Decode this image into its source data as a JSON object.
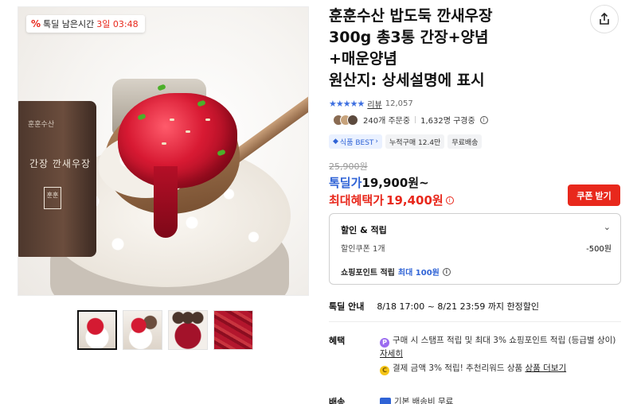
{
  "gallery": {
    "timer_badge": {
      "icon": "percent-icon",
      "label": "톡딜 남은시간",
      "time": "3일 03:48"
    },
    "jar_text": {
      "top": "훈훈수산",
      "label": "간장 깐새우장",
      "seal": "훈훈"
    },
    "thumbnails": 4
  },
  "product": {
    "title_lines": [
      "훈훈수산 밥도둑 깐새우장",
      "300g 총3통 간장+양념",
      "+매운양념",
      "원산지: 상세설명에 표시"
    ],
    "rating": {
      "stars": "★★★★★",
      "review_label": "리뷰",
      "review_count": "12,057"
    },
    "buyers": {
      "orders": "240개 주문중",
      "subscribers": "1,632명 구경중"
    },
    "tags": [
      {
        "label": "식품 BEST",
        "icon": "best-badge-icon"
      },
      {
        "label": "누적구매 12.4만"
      },
      {
        "label": "무료배송"
      }
    ],
    "price": {
      "original": "25,900원",
      "deal_label": "톡딜가",
      "deal_value": "19,900원~",
      "max_label": "최대혜택가",
      "max_value": "19,400원"
    },
    "coupon_button": "쿠폰 받기"
  },
  "discount": {
    "title": "할인 & 적립",
    "coupon_label": "할인쿠폰 1개",
    "coupon_amount": "-500원",
    "point_label": "쇼핑포인트 적립",
    "point_value": "최대 100원"
  },
  "deal_guide": {
    "label": "톡딜 안내",
    "text": "8/18 17:00 ~ 8/21 23:59 까지 한정할인"
  },
  "benefit": {
    "label": "혜택",
    "item1": {
      "icon_char": "P",
      "text": "구매 시 스탬프 적립 및 최대 3% 쇼핑포인트 적립 (등급별 상이)",
      "link": "자세히"
    },
    "item2": {
      "icon_char": "C",
      "text": "결제 금액 3% 적립! 추천리워드 상품",
      "link": "상품 더보기"
    }
  },
  "shipping": {
    "label": "배송",
    "text": "기본 배송비 무료"
  },
  "colors": {
    "accent_red": "#e8281c",
    "accent_blue": "#2f63d6",
    "star_blue": "#3d6fe0"
  }
}
